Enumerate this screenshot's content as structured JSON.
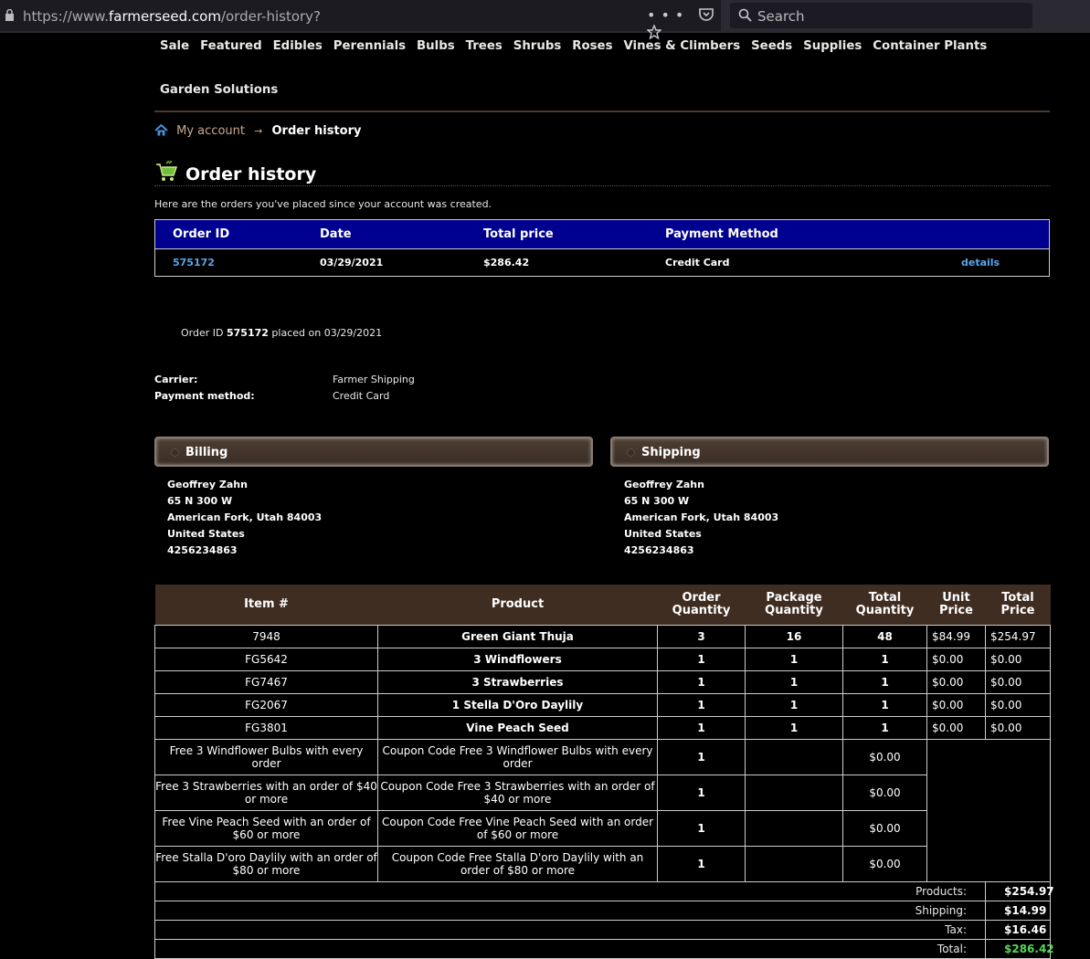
{
  "browser": {
    "url_prefix": "https://www.",
    "url_host": "farmerseed.com",
    "url_path": "/order-history?",
    "search_placeholder": "Search",
    "more_label": "•••"
  },
  "nav": {
    "row1": [
      "Sale",
      "Featured",
      "Edibles",
      "Perennials",
      "Bulbs",
      "Trees",
      "Shrubs",
      "Roses",
      "Vines & Climbers",
      "Seeds",
      "Supplies",
      "Container Plants"
    ],
    "row2": [
      "Garden Solutions"
    ]
  },
  "breadcrumb": {
    "account": "My account",
    "current": "Order history"
  },
  "page": {
    "title": "Order history",
    "intro": "Here are the orders you've placed since your account was created."
  },
  "orders": {
    "headers": [
      "Order ID",
      "Date",
      "Total price",
      "Payment Method"
    ],
    "rows": [
      {
        "id": "575172",
        "date": "03/29/2021",
        "total": "$286.42",
        "payment": "Credit Card",
        "details": "details"
      }
    ]
  },
  "detail": {
    "placed_prefix": "Order ID",
    "order_id": "575172",
    "placed_suffix": "placed on 03/29/2021",
    "carrier_label": "Carrier:",
    "carrier": "Farmer Shipping",
    "payment_label": "Payment method:",
    "payment": "Credit Card"
  },
  "billing": {
    "title": "Billing",
    "lines": [
      "Geoffrey Zahn",
      "65 N 300 W",
      "American Fork, Utah 84003",
      "United States",
      "4256234863"
    ]
  },
  "shipping": {
    "title": "Shipping",
    "lines": [
      "Geoffrey Zahn",
      "65 N 300 W",
      "American Fork, Utah 84003",
      "United States",
      "4256234863"
    ]
  },
  "items": {
    "headers": [
      "Item #",
      "Product",
      "Order Quantity",
      "Package Quantity",
      "Total Quantity",
      "Unit Price",
      "Total Price"
    ],
    "rows": [
      [
        "7948",
        "Green Giant Thuja",
        "3",
        "16",
        "48",
        "$84.99",
        "$254.97"
      ],
      [
        "FG5642",
        "3 Windflowers",
        "1",
        "1",
        "1",
        "$0.00",
        "$0.00"
      ],
      [
        "FG7467",
        "3 Strawberries",
        "1",
        "1",
        "1",
        "$0.00",
        "$0.00"
      ],
      [
        "FG2067",
        "1 Stella D'Oro Daylily",
        "1",
        "1",
        "1",
        "$0.00",
        "$0.00"
      ],
      [
        "FG3801",
        "Vine Peach Seed",
        "1",
        "1",
        "1",
        "$0.00",
        "$0.00"
      ]
    ],
    "promos": [
      [
        "Free 3 Windflower Bulbs with every order",
        "Coupon Code Free 3 Windflower Bulbs with every order",
        "1",
        "$0.00"
      ],
      [
        "Free 3 Strawberries with an order of $40 or more",
        "Coupon Code Free 3 Strawberries with an order of $40 or more",
        "1",
        "$0.00"
      ],
      [
        "Free Vine Peach Seed with an order of $60 or more",
        "Coupon Code Free Vine Peach Seed with an order of $60 or more",
        "1",
        "$0.00"
      ],
      [
        "Free Stalla D'oro Daylily with an order of $80 or more",
        "Coupon Code Free Stalla D'oro Daylily with an order of $80 or more",
        "1",
        "$0.00"
      ]
    ],
    "totals": [
      {
        "label": "Products:",
        "value": "$254.97"
      },
      {
        "label": "Shipping:",
        "value": "$14.99"
      },
      {
        "label": "Tax:",
        "value": "$16.46"
      },
      {
        "label": "Total:",
        "value": "$286.42"
      }
    ]
  },
  "colors": {
    "header_blue": "#000090",
    "brown": "#3f2d22",
    "link": "#5aa5e8",
    "total_green": "#58d658"
  }
}
